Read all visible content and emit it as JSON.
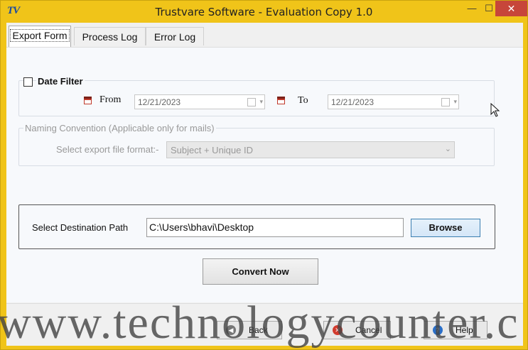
{
  "window": {
    "app_icon": "TV",
    "title": "Trustvare Software - Evaluation Copy 1.0",
    "min_glyph": "—",
    "max_glyph": "☐",
    "close_glyph": "✕"
  },
  "tabs": [
    {
      "label": "Export Form",
      "active": true
    },
    {
      "label": "Process Log",
      "active": false
    },
    {
      "label": "Error Log",
      "active": false
    }
  ],
  "date_filter": {
    "label": "Date Filter",
    "checked": false,
    "from_label": "From",
    "from_value": "12/21/2023",
    "to_label": "To",
    "to_value": "12/21/2023"
  },
  "naming": {
    "legend": "Naming Convention (Applicable only for mails)",
    "format_label": "Select export file format:-",
    "format_value": "Subject + Unique ID"
  },
  "destination": {
    "label": "Select Destination Path",
    "path": "C:\\Users\\bhavi\\Desktop",
    "browse_label": "Browse"
  },
  "convert_label": "Convert Now",
  "footer": {
    "back_label": "Back",
    "cancel_label": "Cancel",
    "help_label": "Help"
  },
  "watermark": "www.technologycounter.c",
  "colors": {
    "titlebar": "#f0c419",
    "close_button": "#c7463a",
    "browse_border": "#3c7fb1"
  }
}
